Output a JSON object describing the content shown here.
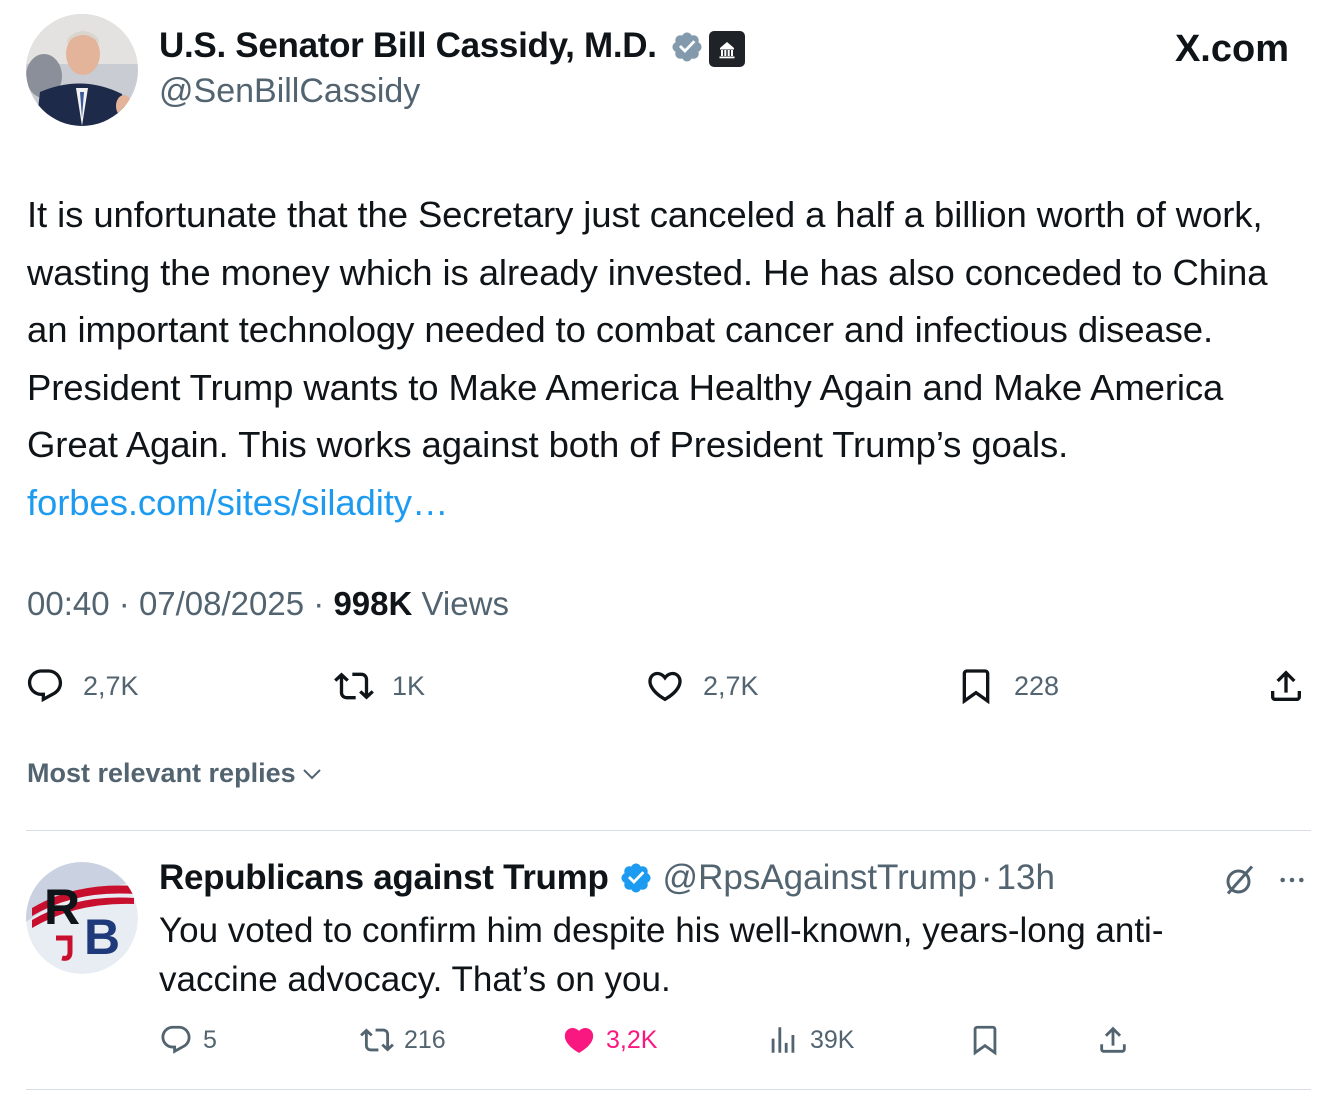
{
  "site": {
    "brand": "X.com"
  },
  "tweet": {
    "author": {
      "display_name": "U.S. Senator Bill Cassidy, M.D.",
      "handle": "@SenBillCassidy",
      "verified_color": "#829aab"
    },
    "text": "It is unfortunate that the Secretary just canceled a half a billion worth of work, wasting the money which is already invested. He has also conceded to China an important technology needed to combat cancer and infectious disease. President Trump wants to Make America Healthy Again and Make America Great Again. This works against both of President Trump’s goals. ",
    "link": "forbes.com/sites/siladity…",
    "time": "00:40",
    "date": "07/08/2025",
    "views_count": "998K",
    "views_label": "Views",
    "actions": {
      "replies": "2,7K",
      "reposts": "1K",
      "likes": "2,7K",
      "bookmarks": "228"
    }
  },
  "replies_sort": {
    "label": "Most relevant replies"
  },
  "reply": {
    "display_name": "Republicans against Trump",
    "handle": "@RpsAgainstTrump",
    "time": "13h",
    "text": "You voted to confirm him despite his well-known, years-long anti-vaccine advocacy. That’s on you.",
    "actions": {
      "replies": "5",
      "reposts": "216",
      "likes": "3,2K",
      "views": "39K"
    }
  },
  "colors": {
    "text": "#0f1419",
    "secondary": "#536471",
    "link": "#1d9bf0",
    "like_active": "#f91880"
  },
  "separator": "·"
}
